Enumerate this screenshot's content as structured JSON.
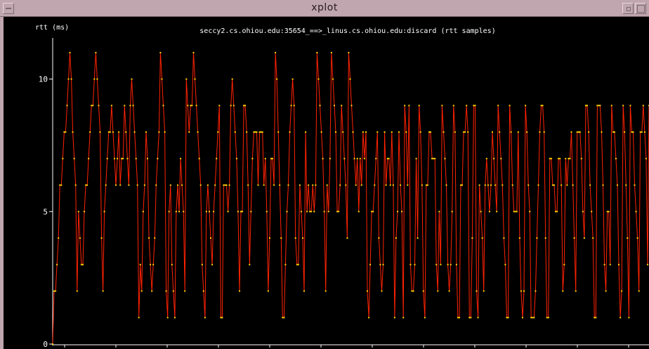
{
  "window": {
    "title": "xplot"
  },
  "chart_data": {
    "type": "line",
    "title": "seccy2.cs.ohiou.edu:35654_==>_linus.cs.ohiou.edu:discard (rtt samples)",
    "ylabel": "rtt (ms)",
    "xlabel": "",
    "y_ticks": [
      0,
      5,
      10
    ],
    "ylim": [
      0,
      11.5
    ],
    "grid": false,
    "colors": {
      "line": "#ff2200",
      "point": "#ffd400",
      "axis": "#ffffff",
      "text": "#ffffff"
    },
    "series": [
      {
        "values": [
          0,
          2,
          2,
          3,
          4,
          6,
          6,
          7,
          8,
          8,
          9,
          10,
          11,
          10,
          8,
          7,
          6,
          2,
          5,
          4,
          3,
          3,
          5,
          6,
          6,
          7,
          8,
          9,
          9,
          10,
          11,
          10,
          9,
          8,
          4,
          2,
          5,
          6,
          7,
          8,
          8,
          9,
          8,
          7,
          6,
          7,
          8,
          6,
          7,
          7,
          9,
          8,
          7,
          6,
          9,
          10,
          9,
          8,
          7,
          6,
          1,
          3,
          2,
          5,
          6,
          8,
          7,
          4,
          3,
          2,
          3,
          4,
          6,
          7,
          8,
          11,
          10,
          9,
          8,
          2,
          1,
          5,
          6,
          3,
          2,
          1,
          5,
          6,
          5,
          7,
          6,
          5,
          2,
          10,
          9,
          8,
          9,
          9,
          11,
          10,
          9,
          8,
          7,
          6,
          3,
          2,
          1,
          5,
          6,
          5,
          4,
          3,
          5,
          6,
          7,
          8,
          9,
          1,
          1,
          6,
          6,
          6,
          5,
          6,
          9,
          10,
          9,
          8,
          7,
          5,
          2,
          5,
          5,
          9,
          9,
          8,
          6,
          3,
          5,
          7,
          8,
          8,
          8,
          6,
          8,
          8,
          8,
          6,
          7,
          5,
          2,
          4,
          7,
          7,
          6,
          11,
          10,
          8,
          6,
          4,
          1,
          1,
          3,
          5,
          6,
          8,
          9,
          10,
          9,
          4,
          3,
          3,
          6,
          5,
          4,
          2,
          8,
          5,
          6,
          5,
          5,
          6,
          5,
          6,
          11,
          10,
          9,
          8,
          7,
          5,
          2,
          6,
          5,
          7,
          11,
          10,
          9,
          8,
          5,
          5,
          6,
          9,
          8,
          7,
          6,
          4,
          11,
          10,
          9,
          8,
          7,
          6,
          7,
          5,
          7,
          6,
          8,
          7,
          8,
          2,
          1,
          3,
          5,
          5,
          6,
          7,
          8,
          4,
          3,
          2,
          3,
          8,
          6,
          7,
          7,
          6,
          8,
          6,
          1,
          4,
          5,
          8,
          6,
          5,
          1,
          9,
          8,
          6,
          9,
          3,
          2,
          2,
          3,
          7,
          4,
          9,
          8,
          6,
          2,
          1,
          6,
          6,
          8,
          8,
          7,
          7,
          7,
          3,
          2,
          5,
          3,
          9,
          8,
          7,
          6,
          3,
          2,
          3,
          5,
          9,
          8,
          3,
          1,
          1,
          6,
          6,
          8,
          8,
          9,
          8,
          1,
          1,
          4,
          9,
          9,
          2,
          1,
          6,
          5,
          4,
          2,
          6,
          7,
          6,
          5,
          6,
          8,
          7,
          6,
          5,
          9,
          8,
          7,
          6,
          4,
          3,
          1,
          1,
          9,
          8,
          6,
          5,
          5,
          5,
          8,
          4,
          2,
          1,
          2,
          9,
          8,
          6,
          5,
          1,
          1,
          1,
          2,
          4,
          6,
          8,
          9,
          9,
          8,
          4,
          1,
          1,
          7,
          7,
          6,
          6,
          5,
          5,
          7,
          7,
          6,
          2,
          3,
          7,
          6,
          7,
          7,
          8,
          6,
          4,
          2,
          8,
          8,
          8,
          7,
          5,
          4,
          9,
          9,
          8,
          6,
          5,
          4,
          1,
          1,
          9,
          9,
          9,
          8,
          6,
          3,
          2,
          5,
          5,
          3,
          9,
          8,
          8,
          7,
          6,
          3,
          1,
          2,
          9,
          8,
          6,
          4,
          1,
          9,
          8,
          8,
          6,
          5,
          4,
          2,
          8,
          8,
          9,
          8,
          7,
          3,
          9
        ]
      }
    ]
  }
}
